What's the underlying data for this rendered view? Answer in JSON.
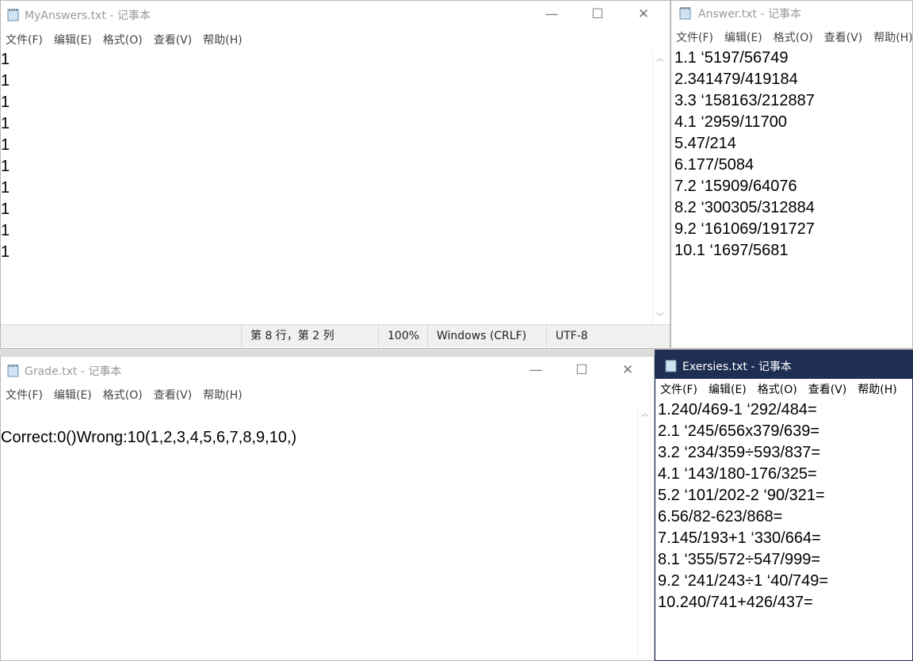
{
  "menu": [
    "文件(F)",
    "编辑(E)",
    "格式(O)",
    "查看(V)",
    "帮助(H)"
  ],
  "controls": {
    "minimize": "—",
    "maximize": "☐",
    "close": "✕"
  },
  "myanswers": {
    "title": "MyAnswers.txt - 记事本",
    "lines": [
      "1",
      "1",
      "1",
      "1",
      "1",
      "1",
      "1",
      "1",
      "1",
      "1"
    ],
    "status": {
      "position": "第 8 行，第 2 列",
      "zoom": "100%",
      "eol": "Windows (CRLF)",
      "encoding": "UTF-8"
    }
  },
  "answer": {
    "title": "Answer.txt - 记事本",
    "lines": [
      "1.1 ‘5197/56749",
      "2.341479/419184",
      "3.3 ‘158163/212887",
      "4.1 ‘2959/11700",
      "5.47/214",
      "6.177/5084",
      "7.2 ‘15909/64076",
      "8.2 ‘300305/312884",
      "9.2 ‘161069/191727",
      "10.1 ‘1697/5681"
    ]
  },
  "grade": {
    "title": "Grade.txt - 记事本",
    "lines": [
      "",
      "Correct:0()Wrong:10(1,2,3,4,5,6,7,8,9,10,)"
    ]
  },
  "exersies": {
    "title": "Exersies.txt - 记事本",
    "lines": [
      "1.240/469-1 ‘292/484=",
      "2.1 ‘245/656x379/639=",
      "3.2 ‘234/359÷593/837=",
      "4.1 ‘143/180-176/325=",
      "5.2 ‘101/202-2 ‘90/321=",
      "6.56/82-623/868=",
      "7.145/193+1 ‘330/664=",
      "8.1 ‘355/572÷547/999=",
      "9.2 ‘241/243÷1 ‘40/749=",
      "10.240/741+426/437="
    ]
  }
}
